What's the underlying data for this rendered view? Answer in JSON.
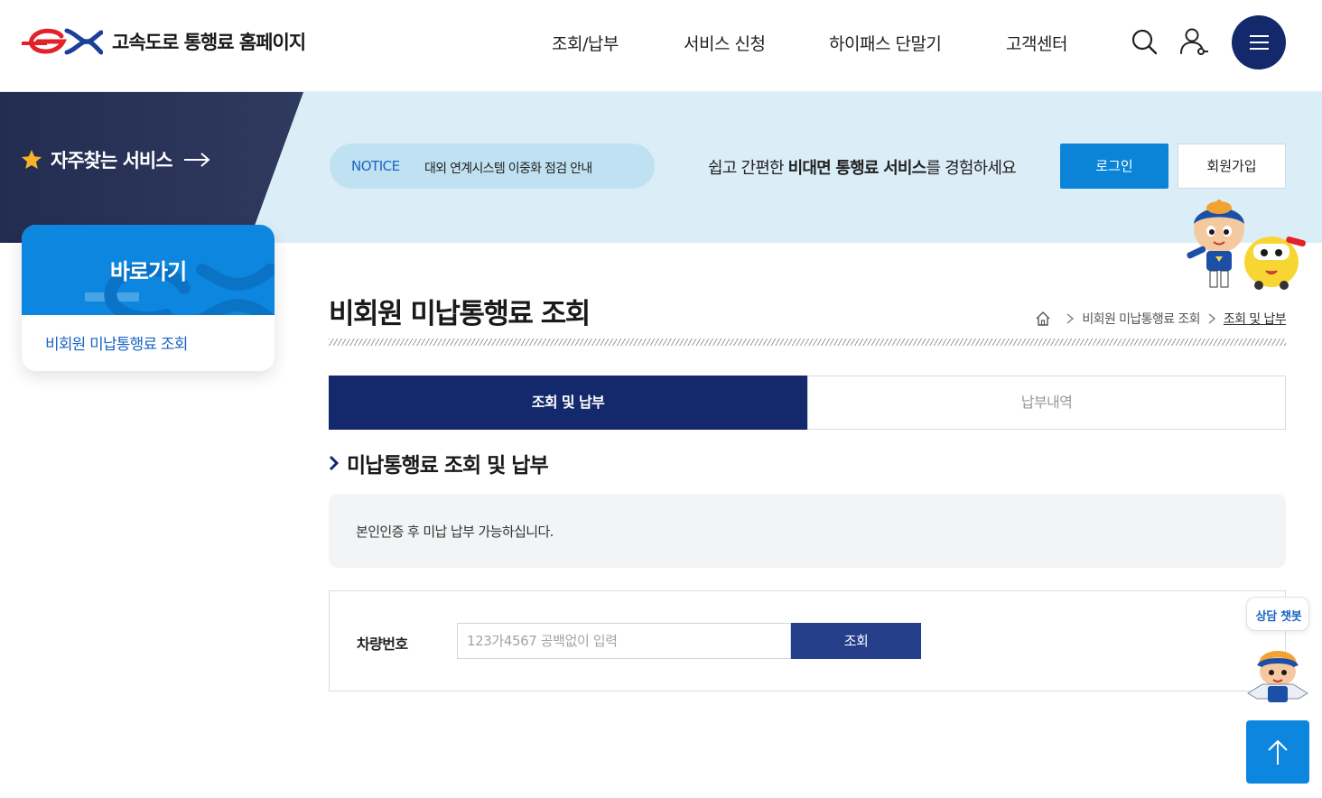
{
  "header": {
    "logo_text": "고속도로 통행료 홈페이지",
    "nav": [
      {
        "label": "조회/납부"
      },
      {
        "label": "서비스 신청"
      },
      {
        "label": "하이패스 단말기"
      },
      {
        "label": "고객센터"
      }
    ],
    "icons": [
      "ex-logo-icon",
      "search-icon",
      "user-icon",
      "menu-icon"
    ]
  },
  "banner": {
    "favorites_label": "자주찾는 서비스",
    "notice_tag": "NOTICE",
    "notice_text": "대외 연계시스템 이중화 점검 안내",
    "copy_prefix": "쉽고 간편한 ",
    "copy_bold": "비대면 통행료 서비스",
    "copy_suffix": "를 경험하세요",
    "login_label": "로그인",
    "join_label": "회원가입"
  },
  "quick": {
    "title": "바로가기",
    "link": "비회원 미납통행료 조회"
  },
  "page": {
    "title": "비회원 미납통행료 조회",
    "breadcrumb": [
      "비회원 미납통행료 조회",
      "조회 및 납부"
    ]
  },
  "tabs": [
    {
      "label": "조회 및 납부",
      "active": true
    },
    {
      "label": "납부내역",
      "active": false
    }
  ],
  "section": {
    "title": "미납통행료 조회 및 납부",
    "info": "본인인증 후 미납 납부 가능하십니다."
  },
  "form": {
    "label": "차량번호",
    "value": "",
    "placeholder": "123가4567 공백없이 입력",
    "button": "조회"
  },
  "floating": {
    "chat_label": "상담 챗봇"
  },
  "colors": {
    "navy": "#13296b",
    "blue": "#0c86de",
    "button_navy": "#253f8b",
    "logo_red": "#e32129",
    "logo_blue": "#1b3f9a"
  }
}
